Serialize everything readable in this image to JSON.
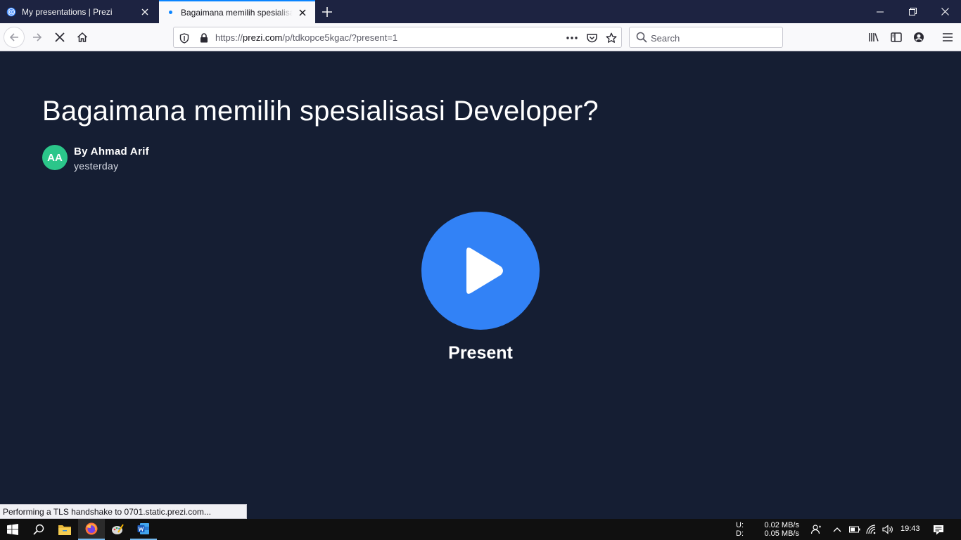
{
  "browser": {
    "tabs": [
      {
        "title": "My presentations | Prezi",
        "active": false
      },
      {
        "title": "Bagaimana memilih spesialisasi Developer?",
        "active": true
      }
    ],
    "url": {
      "prefix": "https://",
      "domain": "prezi.com",
      "path": "/p/tdkopce5kgac/?present=1"
    },
    "search_placeholder": "Search",
    "status_text": "Performing a TLS handshake to 0701.static.prezi.com...",
    "accent": "#0a84ff"
  },
  "presentation": {
    "title": "Bagaimana memilih spesialisasi Developer?",
    "avatar_initials": "AA",
    "author": "By Ahmad Arif",
    "updated": "yesterday",
    "present_label": "Present",
    "background_color": "#151e33",
    "play_color": "#3282f6",
    "avatar_color": "#2bc68a"
  },
  "taskbar": {
    "net_up_label": "U:",
    "net_up": "0.02 MB/s",
    "net_down_label": "D:",
    "net_down": "0.05 MB/s",
    "time": "19:43"
  }
}
